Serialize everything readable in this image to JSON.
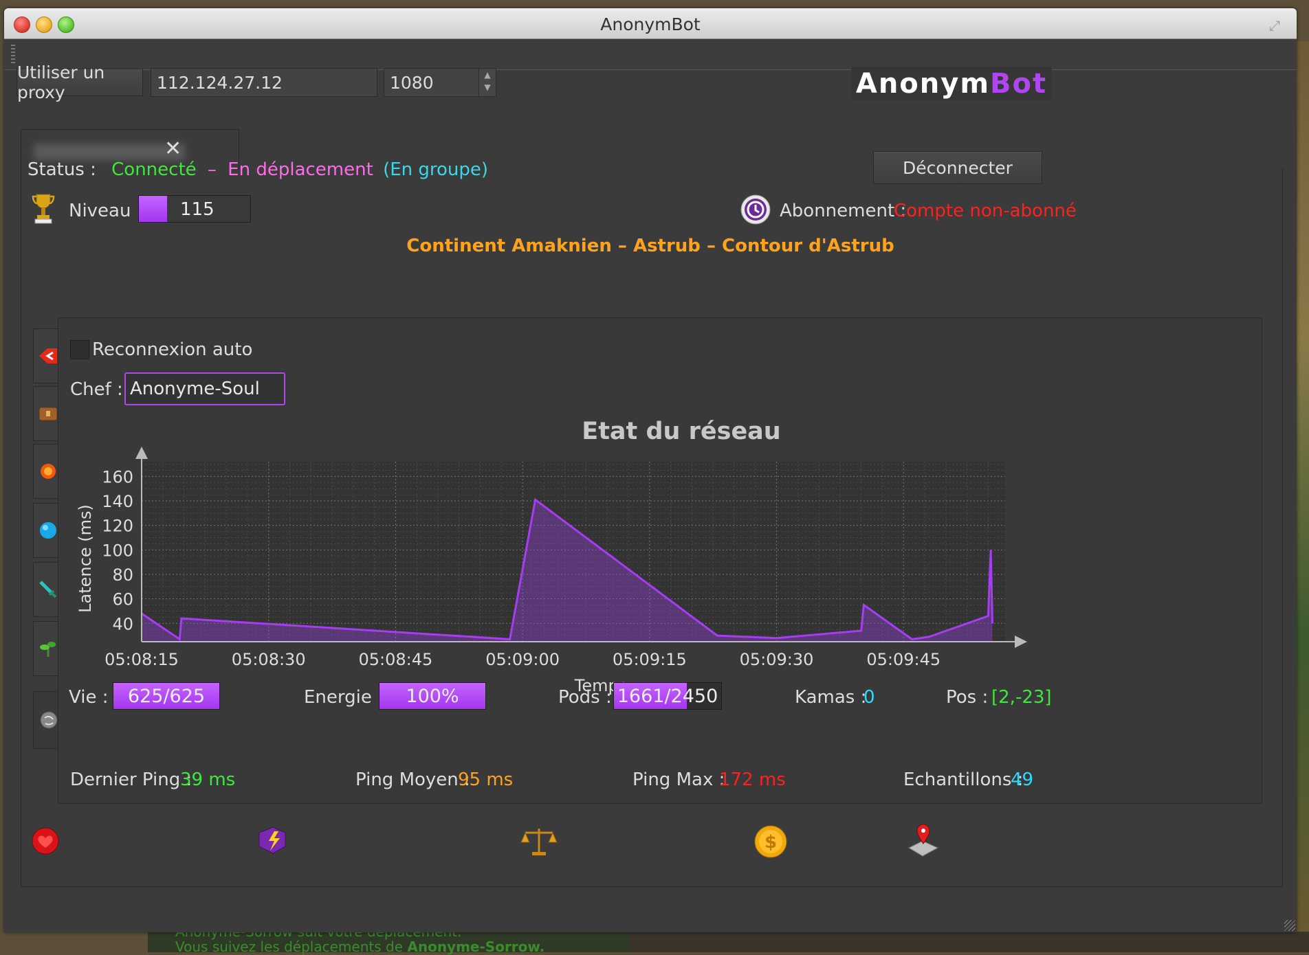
{
  "window": {
    "title": "AnonymBot"
  },
  "logo": {
    "part1": "Anonym",
    "part2": "Bot"
  },
  "proxy": {
    "button_label": "Utiliser un proxy",
    "ip_value": "112.124.27.12",
    "port_value": "1080"
  },
  "status": {
    "label": "Status :",
    "connection": "Connecté",
    "separator": "–",
    "activity": "En déplacement",
    "group": "(En groupe)",
    "disconnect_label": "Déconnecter"
  },
  "level": {
    "label": "Niveau :",
    "value": "115",
    "progress": 0.25
  },
  "subscription": {
    "label": "Abonnement :",
    "value": "Compte non-abonné"
  },
  "location": "Continent Amaknien – Astrub – Contour d'Astrub",
  "group_settings": {
    "auto_reconnect_label": "Reconnexion auto",
    "auto_reconnect_checked": false,
    "chef_label": "Chef :",
    "chef_value": "Anonyme-Soul"
  },
  "chart_data": {
    "type": "area",
    "title": "Etat du réseau",
    "xlabel": "Temps",
    "ylabel": "Latence (ms)",
    "ylim": [
      25,
      172
    ],
    "xlim": [
      "05:08:15",
      "05:09:57"
    ],
    "y_ticks": [
      40,
      60,
      80,
      100,
      120,
      140,
      160
    ],
    "x_ticks": [
      "05:08:15",
      "05:08:30",
      "05:08:45",
      "05:09:00",
      "05:09:15",
      "05:09:30",
      "05:09:45"
    ],
    "grid": true,
    "series": [
      {
        "x": [
          "05:08:15",
          "05:08:19.5",
          "05:08:19.7",
          "05:08:58.5",
          "05:09:01.5",
          "05:09:23",
          "05:09:30",
          "05:09:40",
          "05:09:40.3",
          "05:09:46",
          "05:09:48",
          "05:09:55",
          "05:09:55.3",
          "05:09:55.5"
        ],
        "values": [
          48,
          27,
          44,
          27,
          141,
          30,
          28,
          34,
          55,
          27,
          29,
          46,
          100,
          40
        ]
      }
    ],
    "color": "#a43ef0"
  },
  "ping": {
    "last_label": "Dernier Ping :",
    "last_value": "39 ms",
    "avg_label": "Ping Moyen :",
    "avg_value": "95 ms",
    "max_label": "Ping Max :",
    "max_value": "172 ms",
    "samples_label": "Echantillons :",
    "samples_value": "49"
  },
  "stats": {
    "life_label": "Vie :",
    "life_value": "625/625",
    "life_progress": 1.0,
    "energy_label": "Energie :",
    "energy_value": "100%",
    "energy_progress": 1.0,
    "pods_label": "Pods :",
    "pods_value": "1661/2450",
    "pods_progress": 0.678,
    "kamas_label": "Kamas :",
    "kamas_value": "0",
    "pos_label": "Pos :",
    "pos_value": "[2,-23]"
  },
  "background_game_text": {
    "line1": "Anonyme-Sorrow suit votre déplacement.",
    "line2_prefix": "Vous suivez les déplacements de ",
    "line2_name": "Anonyme-Sorrow."
  },
  "colors": {
    "accent": "#a43ef0",
    "connected": "#3ee83e",
    "moving": "#ff6ae8",
    "group": "#3ad7e8",
    "location": "#ffa31a",
    "error": "#ff2020",
    "cyan": "#2fd8ff"
  }
}
